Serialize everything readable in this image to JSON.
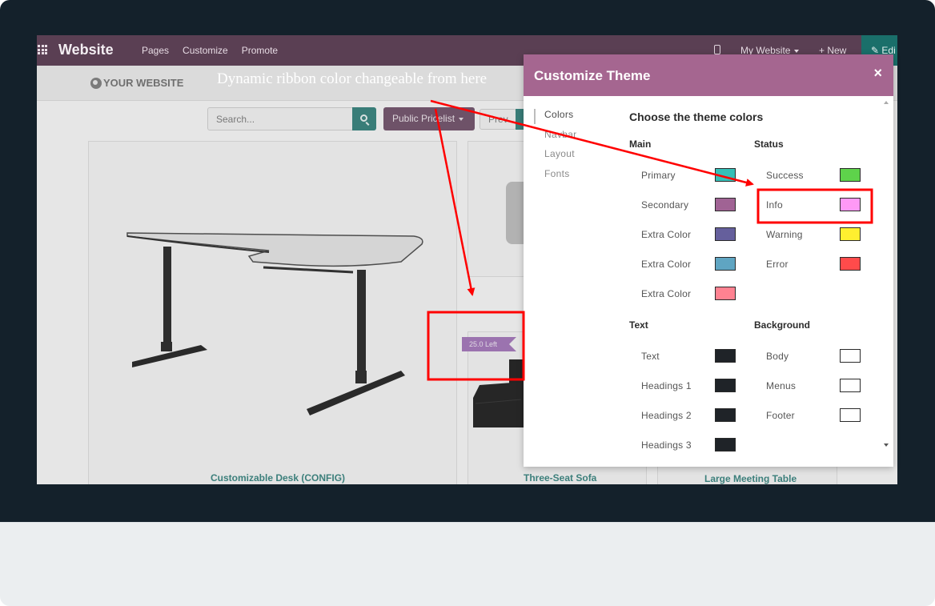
{
  "topbar": {
    "brand": "Website",
    "menu": [
      "Pages",
      "Customize",
      "Promote"
    ],
    "my_website": "My Website",
    "new_label": "+ New",
    "edit_label": "✎ Edi"
  },
  "site": {
    "logo_text": "YOUR WEBSITE",
    "search_placeholder": "Search...",
    "pricelist_label": "Public Pricelist",
    "prev_label": "Prev",
    "ribbon_text": "25.0 Left",
    "products": [
      "Customizable Desk (CONFIG)",
      "Three-Seat Sofa",
      "Large Meeting Table"
    ]
  },
  "annotation": {
    "text": "Dynamic ribbon color changeable from here",
    "color": "#ff0000"
  },
  "modal": {
    "title": "Customize Theme",
    "close": "×",
    "nav": [
      "Colors",
      "Navbar",
      "Layout",
      "Fonts"
    ],
    "heading": "Choose the theme colors",
    "sections": {
      "main": "Main",
      "status": "Status",
      "text": "Text",
      "background": "Background"
    },
    "main_colors": [
      {
        "label": "Primary",
        "color": "#35c0b8"
      },
      {
        "label": "Secondary",
        "color": "#a06394"
      },
      {
        "label": "Extra Color",
        "color": "#655f9c"
      },
      {
        "label": "Extra Color",
        "color": "#5fa5c2"
      },
      {
        "label": "Extra Color",
        "color": "#ff8291"
      }
    ],
    "status_colors": [
      {
        "label": "Success",
        "color": "#5ed34b"
      },
      {
        "label": "Info",
        "color": "#ff99f6"
      },
      {
        "label": "Warning",
        "color": "#ffef30"
      },
      {
        "label": "Error",
        "color": "#ff4b4b"
      }
    ],
    "text_colors": [
      {
        "label": "Text",
        "color": "#1f2328"
      },
      {
        "label": "Headings 1",
        "color": "#1f2328"
      },
      {
        "label": "Headings 2",
        "color": "#1f2328"
      },
      {
        "label": "Headings 3",
        "color": "#1f2328"
      }
    ],
    "background_colors": [
      {
        "label": "Body",
        "color": "#ffffff"
      },
      {
        "label": "Menus",
        "color": "#ffffff"
      },
      {
        "label": "Footer",
        "color": "#ffffff"
      }
    ]
  }
}
